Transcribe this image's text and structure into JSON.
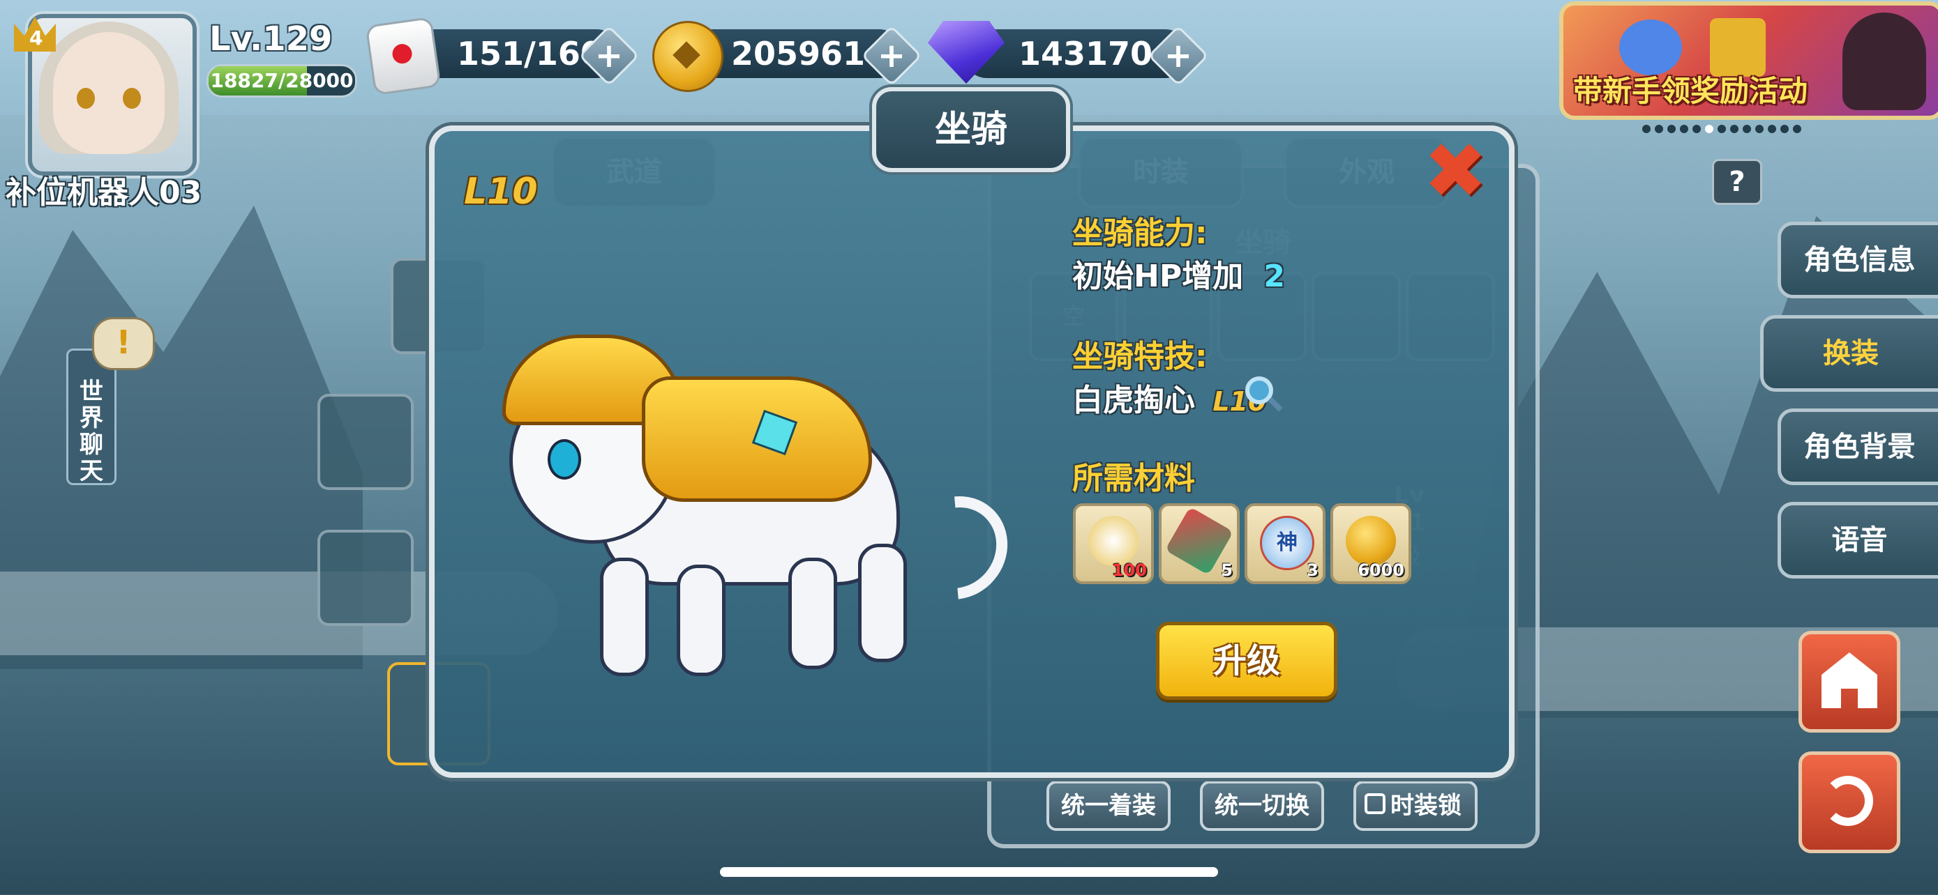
{
  "player": {
    "vip_level": "4",
    "level": "Lv.129",
    "exp_text": "18827/28000",
    "exp_fraction": 0.672,
    "name": "补位机器人03"
  },
  "resources": {
    "stamina": "151/160",
    "gold": "2059614",
    "diamond": "143170",
    "plus_label": "+"
  },
  "banner": {
    "text": "带新手领奖励活动"
  },
  "side_menu": [
    {
      "label": "角色信息",
      "active": false
    },
    {
      "label": "换装",
      "active": true
    },
    {
      "label": "角色背景",
      "active": false
    },
    {
      "label": "语音",
      "active": false
    }
  ],
  "help_label": "?",
  "world_chat": {
    "label": "世界聊天",
    "alert": "!"
  },
  "background_panel": {
    "left_tab": "武道",
    "tab_fashion": "时装",
    "tab_appearance": "外观",
    "section_title": "坐骑",
    "slot_text": "空",
    "btn_unify_dress": "统一着装",
    "btn_unify_switch": "统一切换",
    "btn_fashion_lock": "时装锁",
    "faded_lv": "Lv",
    "faded_count": "11",
    "faded_level": "级"
  },
  "modal": {
    "title": "坐骑",
    "close": "✖",
    "level_badge": "L10",
    "ability_label": "坐骑能力:",
    "ability_text": "初始HP增加",
    "ability_value": "2",
    "skill_label": "坐骑特技:",
    "skill_name": "白虎掏心",
    "skill_level": "L10",
    "materials_label": "所需材料",
    "materials": [
      {
        "name": "white-tiger-fragment",
        "count": "100",
        "insufficient": true
      },
      {
        "name": "feather-fan",
        "count": "5",
        "insufficient": false
      },
      {
        "name": "god-vase",
        "count": "3",
        "insufficient": false,
        "symbol": "神"
      },
      {
        "name": "gold-coin",
        "count": "6000",
        "insufficient": false
      }
    ],
    "upgrade_label": "升级"
  },
  "colors": {
    "accent_yellow": "#ffd033",
    "cyan": "#58e3ff",
    "close_red": "#e74a2a",
    "panel": "#3b6a80"
  }
}
